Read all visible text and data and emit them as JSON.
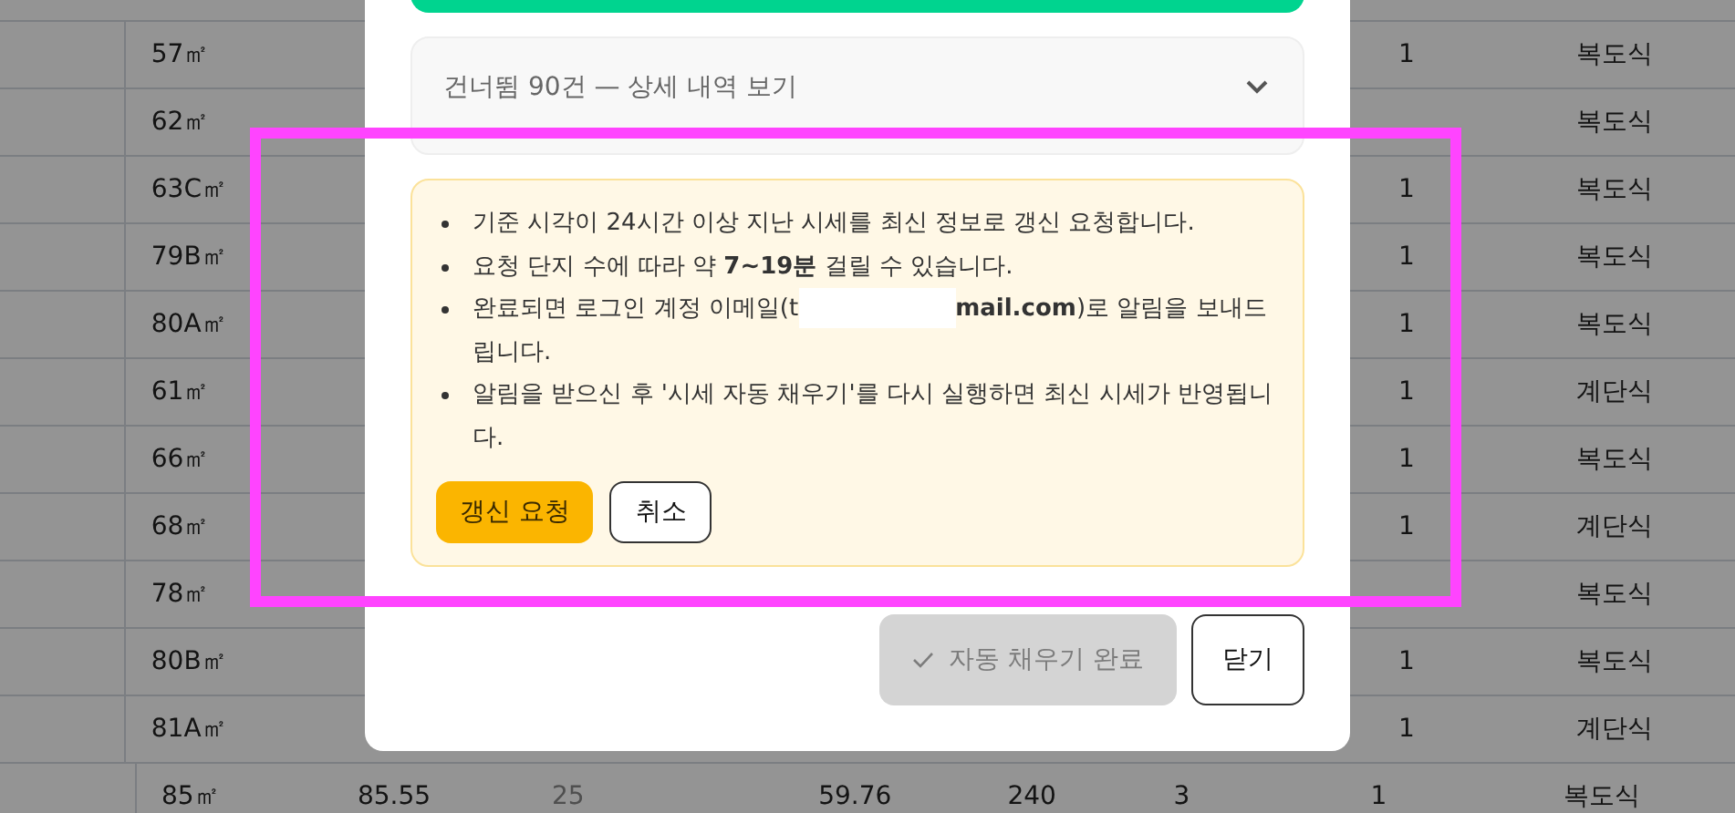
{
  "table": {
    "rows": [
      {
        "area": "57㎡",
        "unit": "1",
        "type": "복도식"
      },
      {
        "area": "62㎡",
        "type": "복도식"
      },
      {
        "area": "63C㎡",
        "unit": "1",
        "type": "복도식"
      },
      {
        "area": "79B㎡",
        "unit": "1",
        "type": "복도식"
      },
      {
        "area": "80A㎡",
        "unit": "1",
        "type": "복도식"
      },
      {
        "area": "61㎡",
        "unit": "1",
        "type": "계단식"
      },
      {
        "area": "66㎡",
        "unit": "1",
        "type": "복도식"
      },
      {
        "area": "68㎡",
        "unit": "1",
        "type": "계단식"
      },
      {
        "area": "78㎡",
        "type": "복도식"
      },
      {
        "area": "80B㎡",
        "unit": "1",
        "type": "복도식"
      },
      {
        "area": "81A㎡",
        "unit": "1",
        "type": "계단식"
      },
      {
        "area": "85㎡",
        "unit": "1",
        "type": "복도식",
        "values": [
          {
            "text": "85.55",
            "muted": false
          },
          {
            "text": "25",
            "muted": true
          },
          {
            "text": "59.76",
            "muted": false
          },
          {
            "text": "240",
            "muted": false
          },
          {
            "text": "3",
            "muted": false
          }
        ]
      }
    ]
  },
  "dialog": {
    "skipped": {
      "label": "건너뜀 90건 — 상세 내역 보기",
      "expanded": false
    },
    "notice": {
      "items": [
        {
          "parts": [
            "기준 시각이 24시간 이상 지난 시세를 최신 정보로 갱신 요청합니다."
          ]
        },
        {
          "parts": [
            "요청 단지 수에 따라 약 **7~19분** 걸릴 수 있습니다."
          ]
        },
        {
          "parts": [
            "완료되면 로그인 계정 이메일(t",
            "**mail.com**)로 알림을 보내드립니다."
          ]
        },
        {
          "parts": [
            "알림을 받으신 후 '시세 자동 채우기'를 다시 실행하면 최신 시세가 반영됩니다."
          ]
        }
      ],
      "buttons": [
        {
          "label": "갱신 요청",
          "kind": "primary"
        },
        {
          "label": "취소",
          "kind": "outline"
        }
      ]
    },
    "footer": [
      {
        "label": "자동 채우기 완료",
        "kind": "done",
        "disabled": true
      },
      {
        "label": "닫기",
        "kind": "outline",
        "disabled": false
      }
    ]
  }
}
